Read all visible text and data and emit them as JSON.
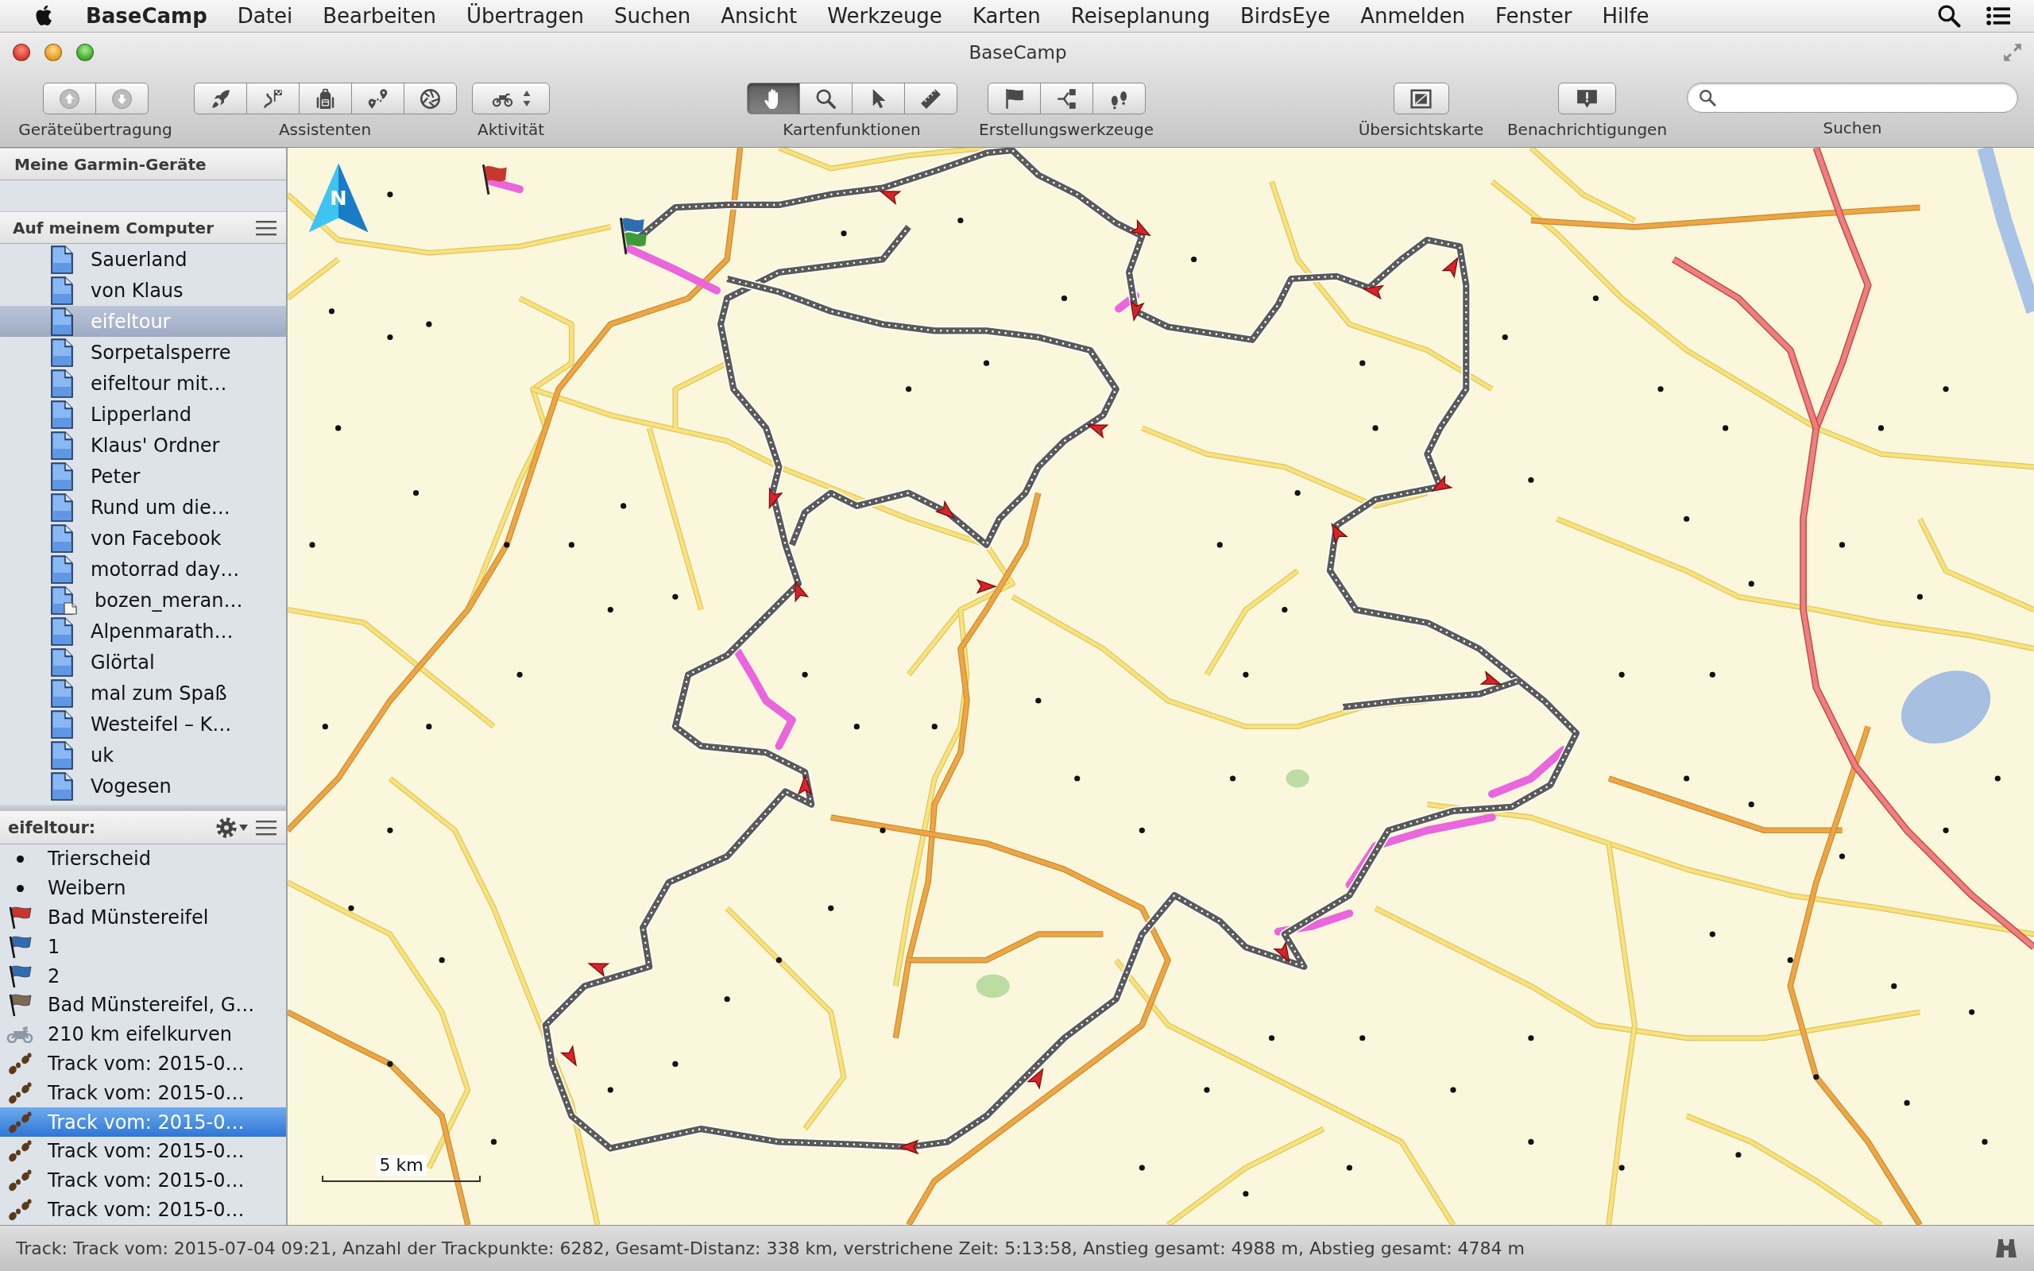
{
  "menu_bar": {
    "app_name": "BaseCamp",
    "items": [
      "Datei",
      "Bearbeiten",
      "Übertragen",
      "Suchen",
      "Ansicht",
      "Werkzeuge",
      "Karten",
      "Reiseplanung",
      "BirdsEye",
      "Anmelden",
      "Fenster",
      "Hilfe"
    ]
  },
  "window": {
    "title": "BaseCamp"
  },
  "toolbar": {
    "groups": [
      {
        "kind": "segmented",
        "label": "Geräteübertragung",
        "buttons": [
          {
            "kind": "upload"
          },
          {
            "kind": "download"
          }
        ]
      },
      {
        "kind": "segmented",
        "label": "Assistenten",
        "buttons": [
          {
            "kind": "rocket"
          },
          {
            "kind": "route-flag"
          },
          {
            "kind": "backpack"
          },
          {
            "kind": "pins"
          },
          {
            "kind": "aperture"
          }
        ]
      },
      {
        "kind": "segmented",
        "label": "Aktivität",
        "buttons": [
          {
            "kind": "motorcycle"
          }
        ]
      },
      {
        "kind": "segmented",
        "label": "Kartenfunktionen",
        "buttons": [
          {
            "kind": "hand",
            "selected": true
          },
          {
            "kind": "magnifier",
            "selected": false
          },
          {
            "kind": "pointer",
            "selected": false
          },
          {
            "kind": "ruler",
            "selected": false
          }
        ]
      },
      {
        "kind": "segmented",
        "label": "Erstellungswerkzeuge",
        "buttons": [
          {
            "kind": "flag"
          },
          {
            "kind": "branch"
          },
          {
            "kind": "footprints"
          }
        ]
      },
      {
        "kind": "segmented",
        "label": "Übersichtskarte",
        "buttons": [
          {
            "kind": "overview"
          }
        ]
      },
      {
        "kind": "segmented",
        "label": "Benachrichtigungen",
        "buttons": [
          {
            "kind": "alert"
          }
        ]
      },
      {
        "kind": "search",
        "label": "Suchen"
      }
    ]
  },
  "sidebar": {
    "devices": {
      "title": "Meine Garmin-Geräte"
    },
    "computer": {
      "title": "Auf meinem Computer",
      "items": [
        {
          "kind": "list",
          "name": "Sauerland",
          "selected": false
        },
        {
          "kind": "list",
          "name": "von Klaus",
          "selected": false
        },
        {
          "kind": "list",
          "name": "eifeltour",
          "selected": true
        },
        {
          "kind": "list",
          "name": "Sorpetalsperre",
          "selected": false
        },
        {
          "kind": "list",
          "name": "eifeltour mit…",
          "selected": false
        },
        {
          "kind": "list",
          "name": "Lipperland",
          "selected": false
        },
        {
          "kind": "list",
          "name": "Klaus' Ordner",
          "selected": false
        },
        {
          "kind": "list",
          "name": "Peter",
          "selected": false
        },
        {
          "kind": "list",
          "name": "Rund um die…",
          "selected": false
        },
        {
          "kind": "list",
          "name": "von Facebook",
          "selected": false
        },
        {
          "kind": "list",
          "name": "motorrad day…",
          "selected": false
        },
        {
          "kind": "list-with-page",
          "name": "bozen_meran…",
          "selected": false
        },
        {
          "kind": "list",
          "name": "Alpenmarath…",
          "selected": false
        },
        {
          "kind": "list",
          "name": "Glörtal",
          "selected": false
        },
        {
          "kind": "list",
          "name": "mal zum Spaß",
          "selected": false
        },
        {
          "kind": "list",
          "name": "Westeifel – K…",
          "selected": false
        },
        {
          "kind": "list",
          "name": "uk",
          "selected": false
        },
        {
          "kind": "list",
          "name": "Vogesen",
          "selected": false
        }
      ]
    },
    "collection": {
      "title": "eifeltour:",
      "items": [
        {
          "kind": "waypoint",
          "name": "Trierscheid",
          "selected": false
        },
        {
          "kind": "waypoint",
          "name": "Weibern",
          "selected": false
        },
        {
          "kind": "flag",
          "name": "Bad Münstereifel",
          "color": "#c8372d",
          "selected": false
        },
        {
          "kind": "flag",
          "name": "1",
          "color": "#2f6db3",
          "selected": false
        },
        {
          "kind": "flag",
          "name": "2",
          "color": "#2f6db3",
          "selected": false
        },
        {
          "kind": "flag",
          "name": "Bad Münstereifel, G…",
          "color": "#7d6a55",
          "selected": false
        },
        {
          "kind": "route",
          "name": "210 km eifelkurven",
          "selected": false
        },
        {
          "kind": "track",
          "name": "Track vom: 2015-0…",
          "selected": false
        },
        {
          "kind": "track",
          "name": "Track vom: 2015-0…",
          "selected": false
        },
        {
          "kind": "track",
          "name": "Track vom: 2015-0…",
          "selected": true
        },
        {
          "kind": "track",
          "name": "Track vom: 2015-0…",
          "selected": false
        },
        {
          "kind": "track",
          "name": "Track vom: 2015-0…",
          "selected": false
        },
        {
          "kind": "track",
          "name": "Track vom: 2015-0…",
          "selected": false
        }
      ]
    }
  },
  "map": {
    "compass": "N",
    "scale": "5 km"
  },
  "status_bar": {
    "text": "Track: Track vom: 2015-07-04 09:21, Anzahl der Trackpunkte: 6282, Gesamt-Distanz: 338 km, verstrichene Zeit: 5:13:58, Anstieg gesamt: 4988 m, Abstieg gesamt: 4784 m"
  }
}
